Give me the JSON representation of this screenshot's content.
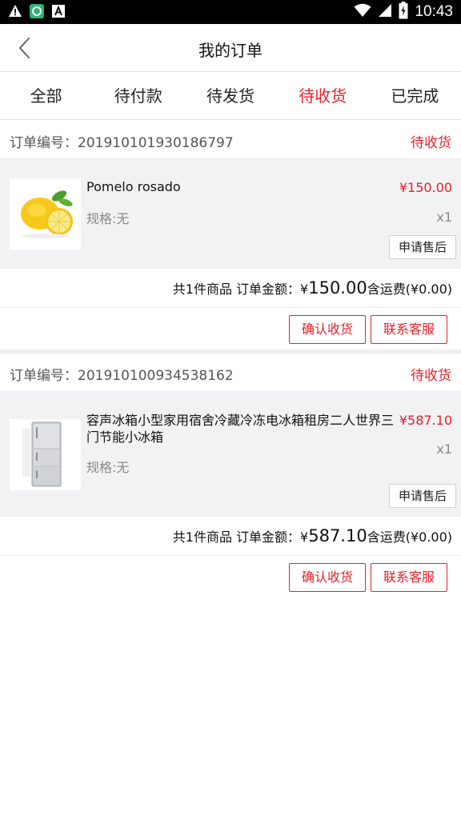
{
  "status_bar": {
    "time": "10:43",
    "left_icons": [
      "warning-icon",
      "app-notification-icon",
      "font-app-icon"
    ],
    "right_icons": [
      "wifi-icon",
      "signal-icon",
      "battery-icon"
    ]
  },
  "header": {
    "title": "我的订单",
    "back_icon": "chevron-left-icon"
  },
  "tabs": [
    {
      "label": "全部",
      "active": false
    },
    {
      "label": "待付款",
      "active": false
    },
    {
      "label": "待发货",
      "active": false
    },
    {
      "label": "待收货",
      "active": true
    },
    {
      "label": "已完成",
      "active": false
    }
  ],
  "orders": [
    {
      "order_no": "订单编号：201910101930186797",
      "status": "待收货",
      "goods": {
        "name": "Pomelo rosado",
        "price": "¥150.00",
        "spec": "规格:无",
        "qty": "x1",
        "after_sale": "申请售后"
      },
      "summary": {
        "prefix": "共1件商品 订单金额：¥",
        "amount": "150.00",
        "suffix": "含运费(¥0.00)"
      },
      "actions": {
        "confirm": "确认收货",
        "contact": "联系客服"
      }
    },
    {
      "order_no": "订单编号：201910100934538162",
      "status": "待收货",
      "goods": {
        "name": "容声冰箱小型家用宿舍冷藏冷冻电冰箱租房二人世界三门节能小冰箱",
        "price": "¥587.10",
        "spec": "规格:无",
        "qty": "x1",
        "after_sale": "申请售后"
      },
      "summary": {
        "prefix": "共1件商品 订单金额：¥",
        "amount": "587.10",
        "suffix": "含运费(¥0.00)"
      },
      "actions": {
        "confirm": "确认收货",
        "contact": "联系客服"
      }
    }
  ],
  "colors": {
    "accent": "#e8202a",
    "goods_bg": "#f2f2f4",
    "text_muted": "#888888"
  }
}
